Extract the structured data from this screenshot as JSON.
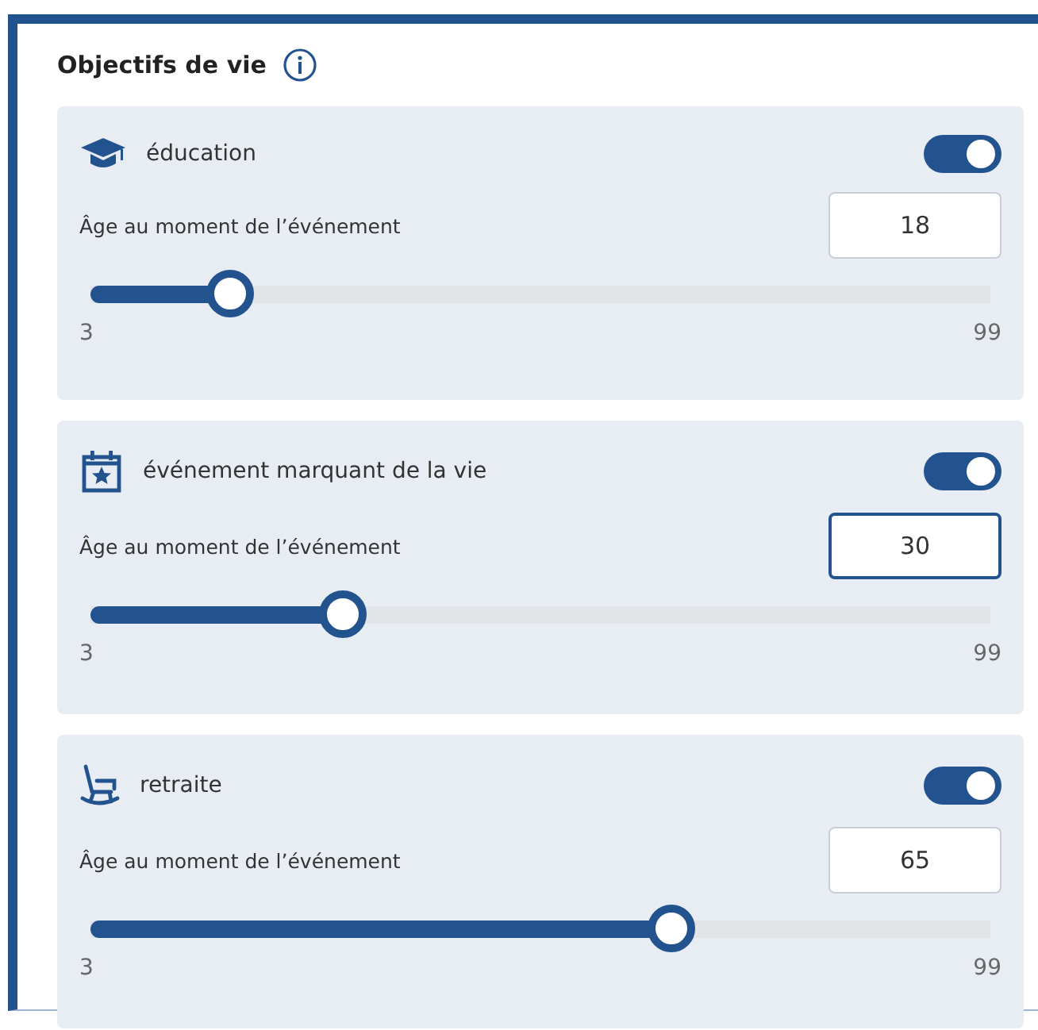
{
  "section": {
    "title": "Objectifs de vie"
  },
  "goals": [
    {
      "kind": "education",
      "title": "éducation",
      "on": true,
      "field_label": "Âge au moment de l’événement",
      "value": "18",
      "focused": false,
      "level": 0.156,
      "min": "3",
      "max": "99"
    },
    {
      "kind": "event",
      "title": "événement marquant de la vie",
      "on": true,
      "field_label": "Âge au moment de l’événement",
      "value": "30",
      "focused": true,
      "level": 0.281,
      "min": "3",
      "max": "99"
    },
    {
      "kind": "retirement",
      "title": "retraite",
      "on": true,
      "field_label": "Âge au moment de l’événement",
      "value": "65",
      "focused": false,
      "level": 0.646,
      "min": "3",
      "max": "99"
    }
  ]
}
